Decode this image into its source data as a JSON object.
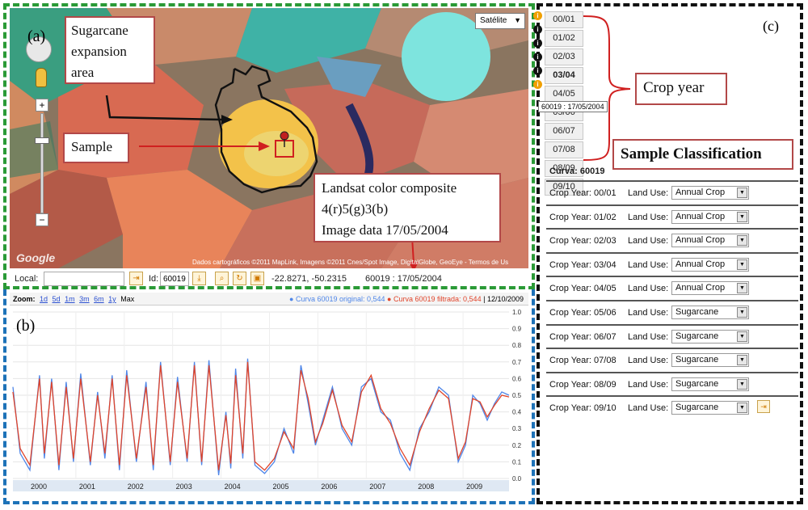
{
  "panel_a": {
    "label": "(a)",
    "map_type": "Satélite",
    "callouts": {
      "expansion": "Sugarcane expansion area",
      "sample": "Sample",
      "landsat_line1": "Landsat color composite",
      "landsat_line2": "4(r)5(g)3(b)",
      "landsat_line3": "Image data 17/05/2004"
    },
    "google_logo": "Google",
    "attribution": "Dados cartográficos ©2011 MapLink, Imagens ©2011 Cnes/Spot Image, DigitalGlobe, GeoEye - Termos de Us",
    "toolbar": {
      "local_label": "Local:",
      "local_value": "",
      "id_label": "Id:",
      "id_value": "60019",
      "coords": "-22.8271, -50.2315",
      "sample_info": "60019 : 17/05/2004"
    }
  },
  "panel_b": {
    "label": "(b)",
    "zoom_label": "Zoom:",
    "zoom_options": [
      "1d",
      "5d",
      "1m",
      "3m",
      "6m",
      "1y",
      "Max"
    ],
    "legend_original": "Curva 60019 original: 0,544",
    "legend_filtered": "Curva 60019 filtrada: 0,544",
    "legend_date": "12/10/2009"
  },
  "panel_c": {
    "label": "(c)",
    "crop_year_callout": "Crop year",
    "classification_callout": "Sample Classification",
    "tooltip": "60019 : 17/05/2004",
    "curve_title": "Curva: 60019",
    "year_tabs": [
      "00/01",
      "01/02",
      "02/03",
      "03/04",
      "04/05",
      "05/06",
      "06/07",
      "07/08",
      "08/09",
      "09/10"
    ],
    "crop_year_label": "Crop Year:",
    "land_use_label": "Land Use:",
    "rows": [
      {
        "year": "00/01",
        "use": "Annual Crop"
      },
      {
        "year": "01/02",
        "use": "Annual Crop"
      },
      {
        "year": "02/03",
        "use": "Annual Crop"
      },
      {
        "year": "03/04",
        "use": "Annual Crop"
      },
      {
        "year": "04/05",
        "use": "Annual Crop"
      },
      {
        "year": "05/06",
        "use": "Sugarcane"
      },
      {
        "year": "06/07",
        "use": "Sugarcane"
      },
      {
        "year": "07/08",
        "use": "Sugarcane"
      },
      {
        "year": "08/09",
        "use": "Sugarcane"
      },
      {
        "year": "09/10",
        "use": "Sugarcane"
      }
    ]
  },
  "colors": {
    "original": "#4f86e8",
    "filtered": "#e0442a",
    "callout_border": "#b24848"
  },
  "chart_data": {
    "type": "line",
    "x_ticks": [
      "2000",
      "2001",
      "2002",
      "2003",
      "2004",
      "2005",
      "2006",
      "2007",
      "2008",
      "2009"
    ],
    "y_ticks": [
      "1.0",
      "0.9",
      "0.8",
      "0.7",
      "0.6",
      "0.5",
      "0.4",
      "0.3",
      "0.2",
      "0.1",
      "0.0"
    ],
    "ylim": [
      0,
      1
    ],
    "xlim": [
      1999.7,
      2009.95
    ],
    "series": [
      {
        "name": "Curva 60019 original",
        "color": "#4f86e8",
        "x": [
          1999.7,
          1999.85,
          2000.05,
          2000.25,
          2000.35,
          2000.5,
          2000.65,
          2000.8,
          2000.95,
          2001.1,
          2001.3,
          2001.45,
          2001.6,
          2001.75,
          2001.9,
          2002.05,
          2002.25,
          2002.45,
          2002.6,
          2002.75,
          2002.95,
          2003.1,
          2003.3,
          2003.45,
          2003.6,
          2003.75,
          2003.95,
          2004.1,
          2004.2,
          2004.3,
          2004.45,
          2004.55,
          2004.7,
          2004.9,
          2005.1,
          2005.3,
          2005.5,
          2005.65,
          2005.8,
          2005.95,
          2006.1,
          2006.3,
          2006.5,
          2006.7,
          2006.9,
          2007.1,
          2007.3,
          2007.5,
          2007.7,
          2007.9,
          2008.1,
          2008.3,
          2008.5,
          2008.7,
          2008.9,
          2009.05,
          2009.2,
          2009.35,
          2009.5,
          2009.65,
          2009.8,
          2009.95
        ],
        "y": [
          0.55,
          0.15,
          0.05,
          0.62,
          0.12,
          0.6,
          0.05,
          0.58,
          0.1,
          0.63,
          0.08,
          0.52,
          0.12,
          0.62,
          0.05,
          0.65,
          0.1,
          0.58,
          0.05,
          0.7,
          0.08,
          0.61,
          0.1,
          0.7,
          0.08,
          0.71,
          0.02,
          0.4,
          0.06,
          0.66,
          0.12,
          0.72,
          0.08,
          0.03,
          0.1,
          0.3,
          0.15,
          0.68,
          0.45,
          0.2,
          0.35,
          0.55,
          0.3,
          0.2,
          0.55,
          0.6,
          0.4,
          0.35,
          0.15,
          0.05,
          0.3,
          0.4,
          0.55,
          0.5,
          0.1,
          0.2,
          0.5,
          0.45,
          0.35,
          0.45,
          0.52,
          0.5
        ]
      },
      {
        "name": "Curva 60019 filtrada",
        "color": "#e0442a",
        "x": [
          1999.7,
          1999.85,
          2000.05,
          2000.25,
          2000.35,
          2000.5,
          2000.65,
          2000.8,
          2000.95,
          2001.1,
          2001.3,
          2001.45,
          2001.6,
          2001.75,
          2001.9,
          2002.05,
          2002.25,
          2002.45,
          2002.6,
          2002.75,
          2002.95,
          2003.1,
          2003.3,
          2003.45,
          2003.6,
          2003.75,
          2003.95,
          2004.1,
          2004.2,
          2004.3,
          2004.45,
          2004.55,
          2004.7,
          2004.9,
          2005.1,
          2005.3,
          2005.5,
          2005.65,
          2005.8,
          2005.95,
          2006.1,
          2006.3,
          2006.5,
          2006.7,
          2006.9,
          2007.1,
          2007.3,
          2007.5,
          2007.7,
          2007.9,
          2008.1,
          2008.3,
          2008.5,
          2008.7,
          2008.9,
          2009.05,
          2009.2,
          2009.35,
          2009.5,
          2009.65,
          2009.8,
          2009.95
        ],
        "y": [
          0.52,
          0.18,
          0.08,
          0.6,
          0.15,
          0.58,
          0.08,
          0.55,
          0.12,
          0.6,
          0.1,
          0.5,
          0.15,
          0.6,
          0.08,
          0.62,
          0.12,
          0.55,
          0.08,
          0.68,
          0.1,
          0.58,
          0.12,
          0.68,
          0.1,
          0.68,
          0.05,
          0.38,
          0.09,
          0.62,
          0.15,
          0.7,
          0.1,
          0.05,
          0.12,
          0.28,
          0.18,
          0.65,
          0.48,
          0.22,
          0.33,
          0.53,
          0.32,
          0.22,
          0.52,
          0.62,
          0.42,
          0.33,
          0.18,
          0.08,
          0.28,
          0.42,
          0.53,
          0.48,
          0.12,
          0.22,
          0.48,
          0.46,
          0.37,
          0.44,
          0.5,
          0.49
        ]
      }
    ]
  }
}
